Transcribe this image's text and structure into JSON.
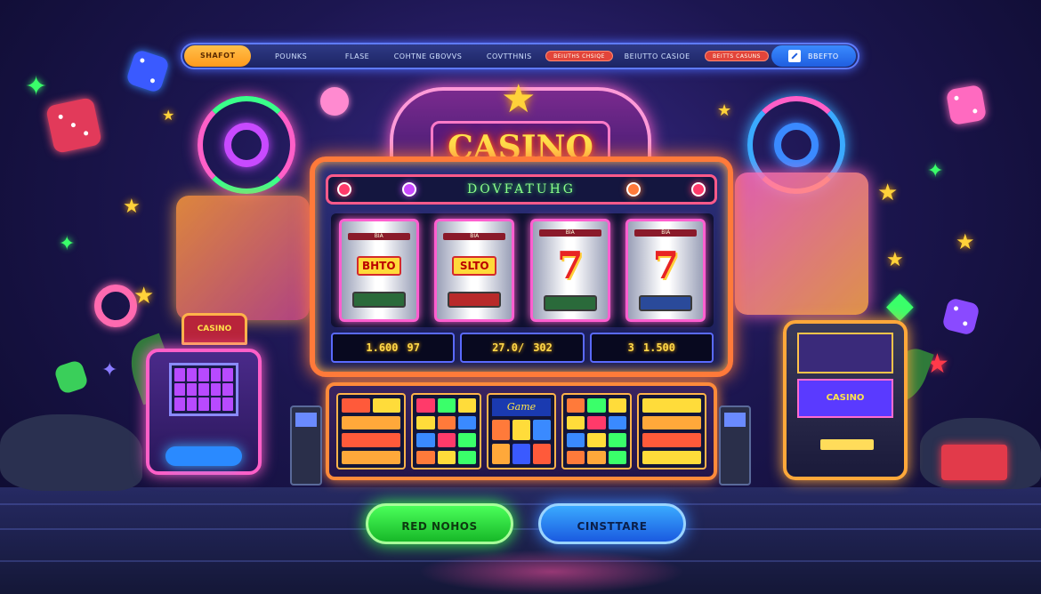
{
  "nav": {
    "items": [
      {
        "label": "SHAFOT",
        "kind": "home"
      },
      {
        "label": "POUNKS",
        "kind": "link"
      },
      {
        "label": "FLASE",
        "kind": "link"
      },
      {
        "label": "COHTNE GBOVVS",
        "kind": "link"
      },
      {
        "label": "COVTTHNIS",
        "kind": "link"
      },
      {
        "label": "BEIUTHS CHSIQE",
        "kind": "badge"
      },
      {
        "label": "BEIUTTO CASIOE",
        "kind": "link"
      },
      {
        "label": "BEITTS CASUNS",
        "kind": "badge"
      }
    ],
    "right": {
      "label": "BBEFTO",
      "icon": "edit-icon"
    }
  },
  "machine": {
    "title": "CASINO",
    "subtitle": "DOVFATUHG",
    "reels": [
      {
        "top": "BIA",
        "symbol": "BHTO",
        "type": "bar"
      },
      {
        "top": "BIA",
        "symbol": "SLTO",
        "type": "bar"
      },
      {
        "top": "BIA",
        "symbol": "7",
        "type": "seven"
      },
      {
        "top": "BIA",
        "symbol": "7",
        "type": "seven"
      }
    ],
    "counters": [
      {
        "a": "1.600",
        "b": "97"
      },
      {
        "a": "27.0/",
        "b": "302"
      },
      {
        "a": "3",
        "b": "1.500"
      }
    ],
    "deck_label": "Game"
  },
  "side_left": {
    "label": "CASINO"
  },
  "side_right": {
    "label": "CASINO"
  },
  "buttons": {
    "primary": "RED NOHOS",
    "secondary": "CINSTTARE"
  },
  "colors": {
    "neon_pink": "#ff5fc8",
    "neon_orange": "#ff7a3a",
    "neon_green": "#3aff4a",
    "neon_blue": "#3a8aff",
    "title_gold": "#ffe04a"
  }
}
